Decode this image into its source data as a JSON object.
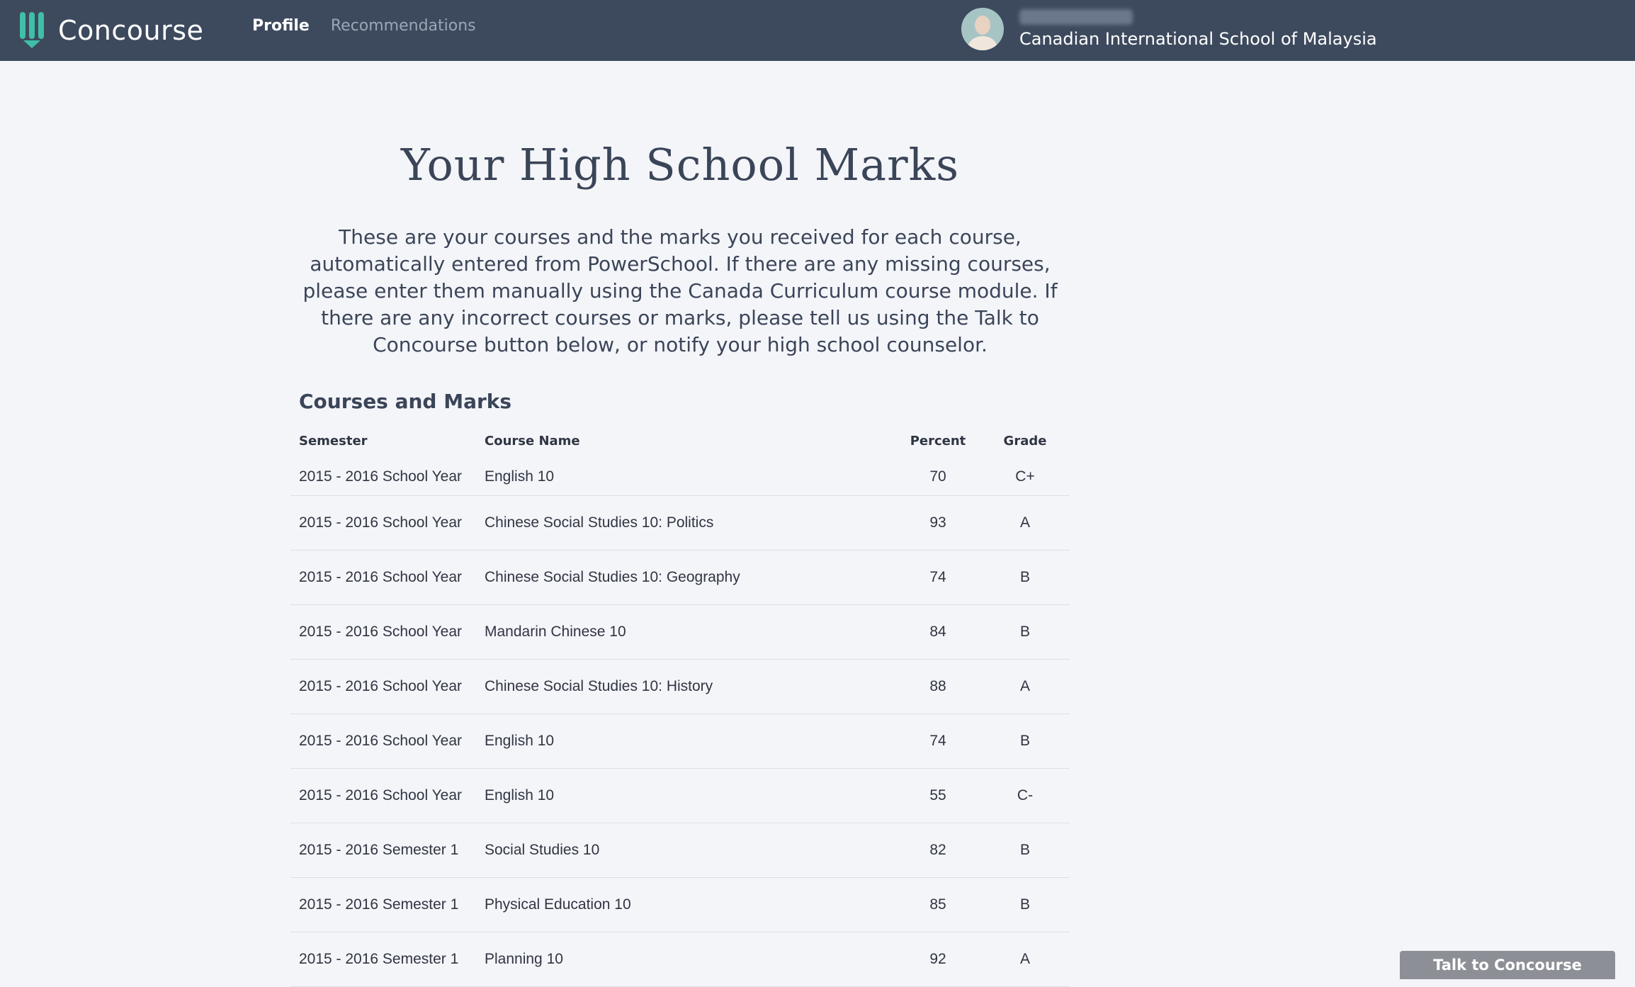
{
  "header": {
    "brand": "Concourse",
    "nav": [
      {
        "label": "Profile",
        "active": true
      },
      {
        "label": "Recommendations",
        "active": false
      }
    ],
    "school": "Canadian International School of Malaysia",
    "accent_color": "#3fbfa9",
    "bar_color": "#3d4a5e"
  },
  "main": {
    "title": "Your High School Marks",
    "intro": "These are your courses and the marks you received for each course, automatically entered from PowerSchool. If there are any missing courses, please enter them manually using the Canada Curriculum course module. If there are any incorrect courses or marks, please tell us using the Talk to Concourse button below, or notify your high school counselor.",
    "section_heading": "Courses and Marks",
    "columns": {
      "semester": "Semester",
      "course": "Course Name",
      "percent": "Percent",
      "grade": "Grade"
    },
    "rows": [
      {
        "semester": "2015 - 2016 School Year",
        "course": "English 10",
        "percent": "70",
        "grade": "C+"
      },
      {
        "semester": "2015 - 2016 School Year",
        "course": "Chinese Social Studies 10: Politics",
        "percent": "93",
        "grade": "A"
      },
      {
        "semester": "2015 - 2016 School Year",
        "course": "Chinese Social Studies 10: Geography",
        "percent": "74",
        "grade": "B"
      },
      {
        "semester": "2015 - 2016 School Year",
        "course": "Mandarin Chinese 10",
        "percent": "84",
        "grade": "B"
      },
      {
        "semester": "2015 - 2016 School Year",
        "course": "Chinese Social Studies 10: History",
        "percent": "88",
        "grade": "A"
      },
      {
        "semester": "2015 - 2016 School Year",
        "course": "English 10",
        "percent": "74",
        "grade": "B"
      },
      {
        "semester": "2015 - 2016 School Year",
        "course": "English 10",
        "percent": "55",
        "grade": "C-"
      },
      {
        "semester": "2015 - 2016 Semester 1",
        "course": "Social Studies 10",
        "percent": "82",
        "grade": "B"
      },
      {
        "semester": "2015 - 2016 Semester 1",
        "course": "Physical Education 10",
        "percent": "85",
        "grade": "B"
      },
      {
        "semester": "2015 - 2016 Semester 1",
        "course": "Planning 10",
        "percent": "92",
        "grade": "A"
      }
    ]
  },
  "chat": {
    "label": "Talk to Concourse"
  }
}
